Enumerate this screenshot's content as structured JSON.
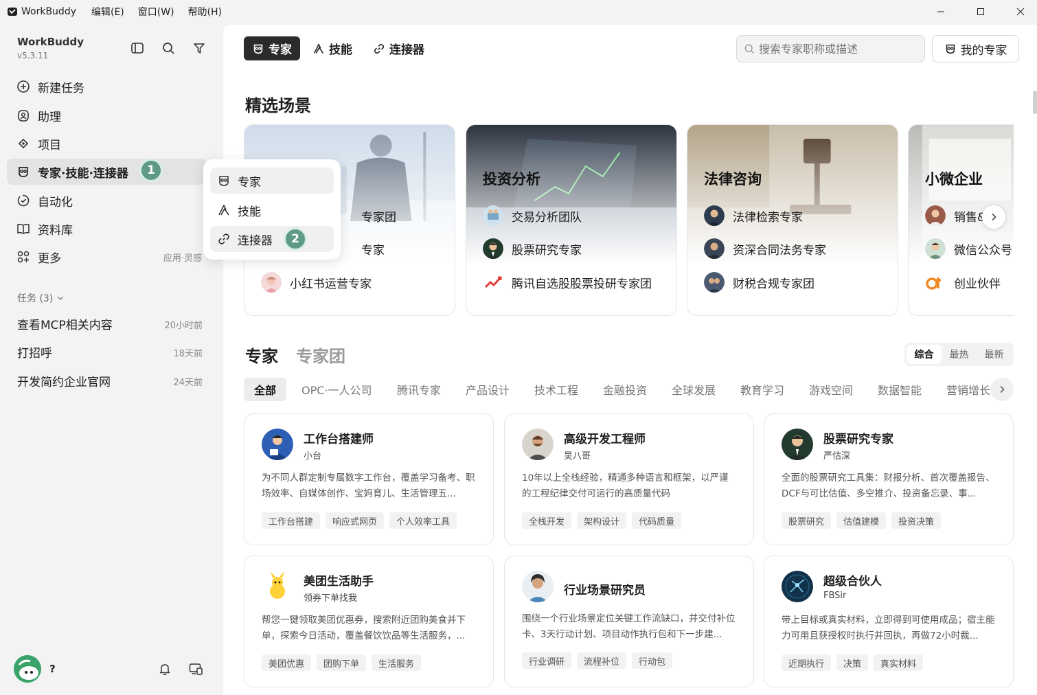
{
  "titlebar": {
    "app_name": "WorkBuddy",
    "menus": [
      "编辑(E)",
      "窗口(W)",
      "帮助(H)"
    ]
  },
  "sidebar": {
    "brand": "WorkBuddy",
    "version": "v5.3.11",
    "nav": [
      {
        "label": "新建任务",
        "icon": "plus-circle-icon"
      },
      {
        "label": "助理",
        "icon": "assistant-icon"
      },
      {
        "label": "项目",
        "icon": "project-icon"
      },
      {
        "label": "专家·技能·连接器",
        "icon": "expert-icon",
        "active": true
      },
      {
        "label": "自动化",
        "icon": "automation-icon"
      },
      {
        "label": "资料库",
        "icon": "book-icon"
      },
      {
        "label": "更多",
        "icon": "grid-icon",
        "extra": "应用·灵感"
      }
    ],
    "step1": "1",
    "tasks_label": "任务 (3)",
    "tasks": [
      {
        "name": "查看MCP相关内容",
        "time": "20小时前"
      },
      {
        "name": "打招呼",
        "time": "18天前"
      },
      {
        "name": "开发简约企业官网",
        "time": "24天前"
      }
    ],
    "user_name": "?"
  },
  "popup": {
    "items": [
      "专家",
      "技能",
      "连接器"
    ],
    "step2": "2"
  },
  "main": {
    "tabs": [
      "专家",
      "技能",
      "连接器"
    ],
    "search_placeholder": "搜索专家职称或描述",
    "my_experts": "我的专家",
    "featured_title": "精选场景",
    "scenes": [
      {
        "title": "",
        "items": [
          "专家团",
          "专家",
          "小红书运营专家"
        ]
      },
      {
        "title": "投资分析",
        "items": [
          "交易分析团队",
          "股票研究专家",
          "腾讯自选股股票投研专家团"
        ]
      },
      {
        "title": "法律咨询",
        "items": [
          "法律检索专家",
          "资深合同法务专家",
          "财税合规专家团"
        ]
      },
      {
        "title": "小微企业",
        "items": [
          "销售&",
          "微信公众号",
          "创业伙伴"
        ]
      }
    ],
    "section_tabs": [
      "专家",
      "专家团"
    ],
    "sort": [
      "综合",
      "最热",
      "最新"
    ],
    "categories": [
      "全部",
      "OPC·一人公司",
      "腾讯专家",
      "产品设计",
      "技术工程",
      "金融投资",
      "全球发展",
      "教育学习",
      "游戏空间",
      "数据智能",
      "营销增长"
    ],
    "cards": [
      {
        "name": "工作台搭建师",
        "author": "小台",
        "desc": "为不同人群定制专属数字工作台，覆盖学习备考、职场效率、自媒体创作、宝妈育儿、生活管理五...",
        "tags": [
          "工作台搭建",
          "响应式网页",
          "个人效率工具"
        ]
      },
      {
        "name": "高级开发工程师",
        "author": "吴八哥",
        "desc": "10年以上全栈经验，精通多种语言和框架，以严谨的工程纪律交付可运行的高质量代码",
        "tags": [
          "全栈开发",
          "架构设计",
          "代码质量"
        ]
      },
      {
        "name": "股票研究专家",
        "author": "严估深",
        "desc": "全面的股票研究工具集：财报分析、首次覆盖报告、DCF与可比估值、多空推介、投资备忘录、事...",
        "tags": [
          "股票研究",
          "估值建模",
          "投资决策"
        ]
      },
      {
        "name": "美团生活助手",
        "author": "领券下单找我",
        "desc": "帮您一键领取美团优惠券，搜索附近团购美食并下单，探索今日活动，覆盖餐饮饮品等生活服务，...",
        "tags": [
          "美团优惠",
          "团购下单",
          "生活服务"
        ]
      },
      {
        "name": "行业场景研究员",
        "author": "",
        "desc": "围绕一个行业场景定位关键工作流缺口，并交付补位卡、3天行动计划、项目动作执行包和下一步建...",
        "tags": [
          "行业调研",
          "流程补位",
          "行动包"
        ]
      },
      {
        "name": "超级合伙人",
        "author": "FBSir",
        "desc": "带上目标或真实材料，立即得到可使用成品；宿主能力可用且获授权时执行并回执，再做72小时裁...",
        "tags": [
          "近期执行",
          "决策",
          "真实材料"
        ]
      }
    ]
  }
}
